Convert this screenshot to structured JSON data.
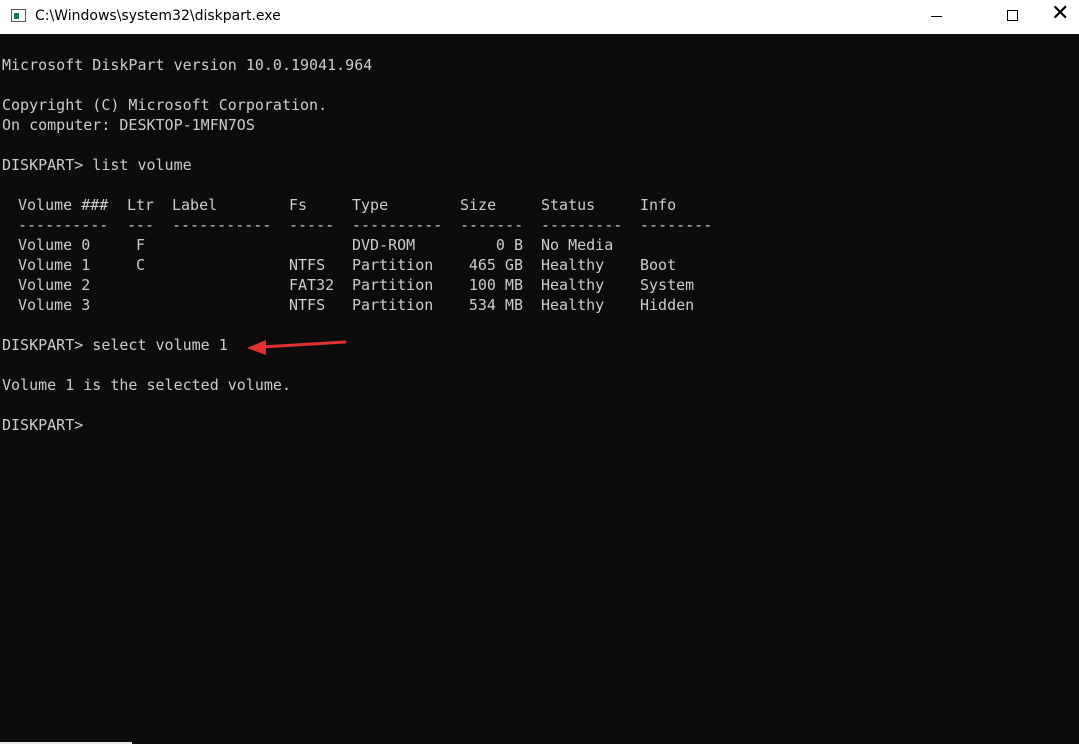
{
  "window": {
    "title": "C:\\Windows\\system32\\diskpart.exe",
    "minimize_icon": "minimize-icon",
    "maximize_icon": "maximize-icon",
    "close_icon": "close-icon",
    "close_glyph": "✕"
  },
  "console": {
    "version_line": "Microsoft DiskPart version 10.0.19041.964",
    "copyright_line": "Copyright (C) Microsoft Corporation.",
    "computer_line": "On computer: DESKTOP-1MFN7OS",
    "prompt1": "DISKPART> list volume",
    "table": {
      "headers": [
        "Volume ###",
        "Ltr",
        "Label",
        "Fs",
        "Type",
        "Size",
        "Status",
        "Info"
      ],
      "separators": [
        "----------",
        "---",
        "-----------",
        "-----",
        "----------",
        "-------",
        "---------",
        "--------"
      ],
      "rows": [
        [
          "Volume 0",
          "F",
          "",
          "",
          "DVD-ROM",
          "0 B",
          "No Media",
          ""
        ],
        [
          "Volume 1",
          "C",
          "",
          "NTFS",
          "Partition",
          "465 GB",
          "Healthy",
          "Boot"
        ],
        [
          "Volume 2",
          "",
          "",
          "FAT32",
          "Partition",
          "100 MB",
          "Healthy",
          "System"
        ],
        [
          "Volume 3",
          "",
          "",
          "NTFS",
          "Partition",
          "534 MB",
          "Healthy",
          "Hidden"
        ]
      ]
    },
    "prompt2": "DISKPART> select volume 1",
    "result_line": "Volume 1 is the selected volume.",
    "prompt3": "DISKPART>"
  },
  "colors": {
    "console_bg": "#0c0c0c",
    "console_text": "#cccccc",
    "annotation_arrow": "#e0312f"
  }
}
